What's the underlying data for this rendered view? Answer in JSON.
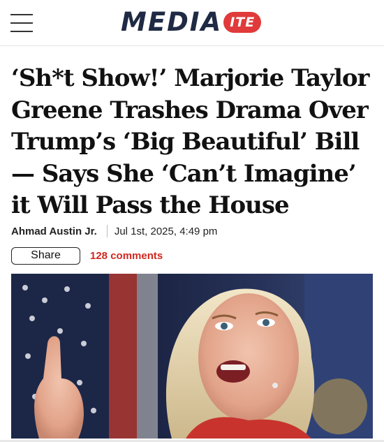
{
  "site": {
    "logo_main": "MEDIA",
    "logo_badge": "ITE"
  },
  "article": {
    "headline": "‘Sh*t Show!’ Marjorie Taylor Greene Trashes Drama Over Trump’s ‘Big Beautiful’ Bill — Says She ‘Can’t Imagine’ it Will Pass the House",
    "author": "Ahmad Austin Jr.",
    "date": "Jul 1st, 2025, 4:49 pm",
    "share_label": "Share",
    "comments_label": "128 comments"
  },
  "colors": {
    "brand_navy": "#1f2a44",
    "brand_red": "#e03a3a",
    "comments_red": "#d0281f"
  },
  "icons": {
    "menu": "hamburger-menu-icon"
  }
}
